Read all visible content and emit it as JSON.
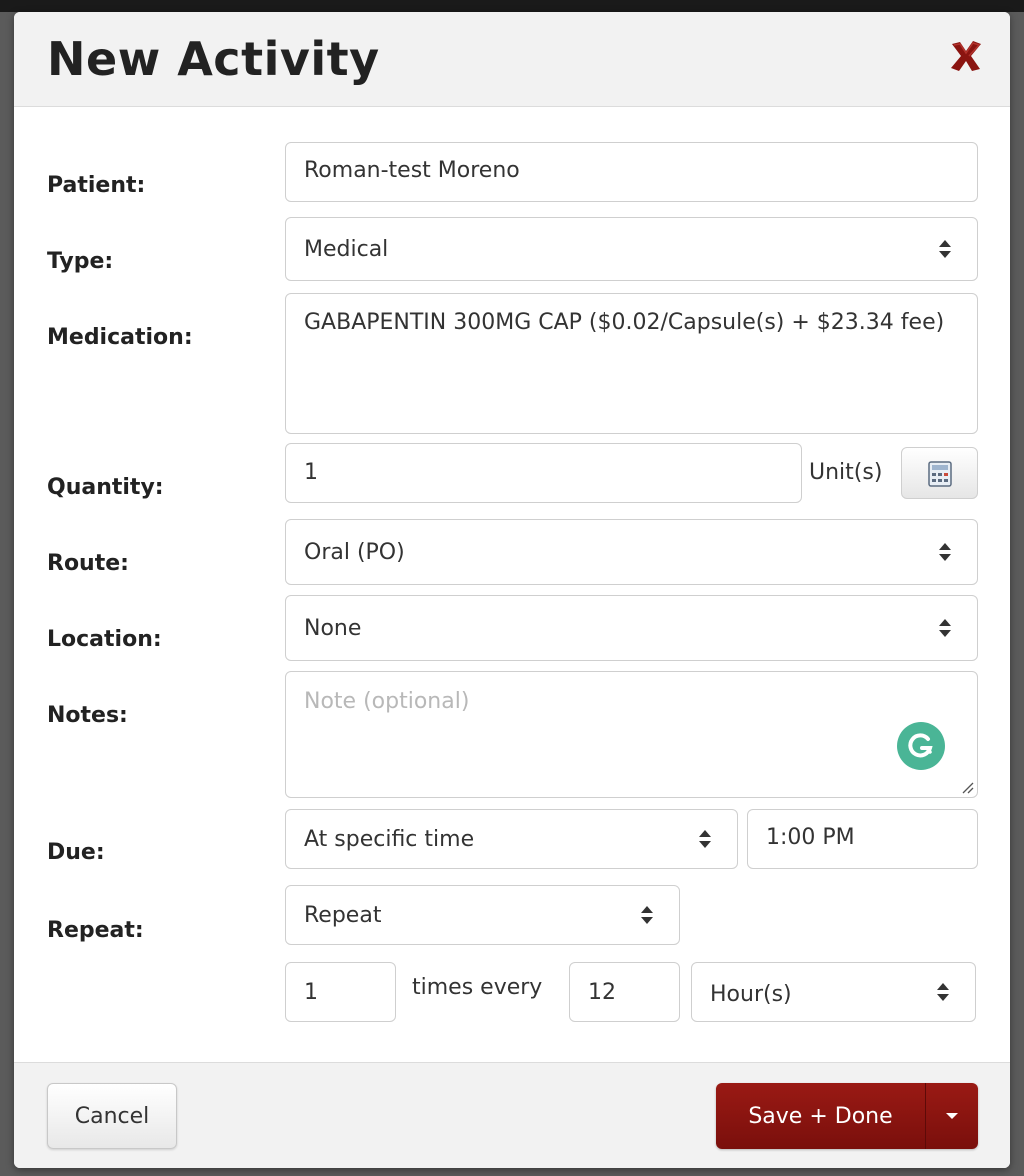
{
  "modal": {
    "title": "New Activity",
    "close_icon": "close-x-icon"
  },
  "form": {
    "patient": {
      "label": "Patient:",
      "value": "Roman-test Moreno"
    },
    "type": {
      "label": "Type:",
      "value": "Medical"
    },
    "medication": {
      "label": "Medication:",
      "value": "GABAPENTIN 300MG CAP ($0.02/Capsule(s) + $23.34 fee)"
    },
    "quantity": {
      "label": "Quantity:",
      "value": "1",
      "unit": "Unit(s)",
      "calc_icon": "calculator-icon"
    },
    "route": {
      "label": "Route:",
      "value": "Oral (PO)"
    },
    "location": {
      "label": "Location:",
      "value": "None"
    },
    "notes": {
      "label": "Notes:",
      "placeholder": "Note (optional)",
      "value": ""
    },
    "due": {
      "label": "Due:",
      "mode": "At specific time",
      "time": "1:00 PM"
    },
    "repeat": {
      "label": "Repeat:",
      "mode": "Repeat",
      "times": "1",
      "times_every_label": "times every",
      "interval": "12",
      "interval_unit": "Hour(s)"
    }
  },
  "footer": {
    "cancel_label": "Cancel",
    "save_label": "Save + Done"
  },
  "colors": {
    "primary_button": "#8a1410",
    "close_icon": "#8a1410",
    "grammarly": "#4ab596"
  }
}
